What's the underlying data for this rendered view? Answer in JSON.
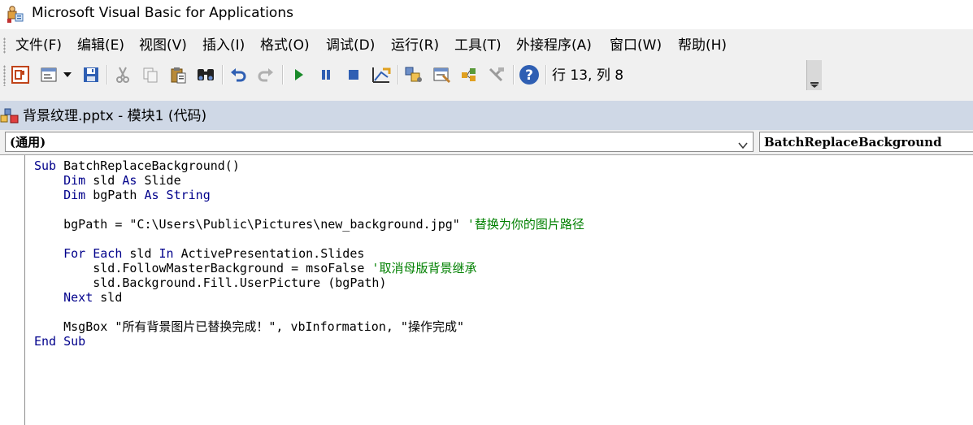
{
  "window": {
    "title": "Microsoft Visual Basic for Applications",
    "icon": "vba-app-icon"
  },
  "menu": [
    {
      "label": "文件(F)"
    },
    {
      "label": "编辑(E)"
    },
    {
      "label": "视图(V)"
    },
    {
      "label": "插入(I)"
    },
    {
      "label": "格式(O)"
    },
    {
      "label": "调试(D)"
    },
    {
      "label": "运行(R)"
    },
    {
      "label": "工具(T)"
    },
    {
      "label": "外接程序(A)"
    },
    {
      "label": "窗口(W)"
    },
    {
      "label": "帮助(H)"
    }
  ],
  "toolbar": {
    "buttons": [
      "view-powerpoint-icon",
      "insert-userform-icon",
      "save-icon",
      "cut-icon",
      "copy-icon",
      "paste-icon",
      "find-icon",
      "undo-icon",
      "redo-icon",
      "run-icon",
      "break-icon",
      "reset-icon",
      "design-mode-icon",
      "project-explorer-icon",
      "properties-window-icon",
      "object-browser-icon",
      "toolbox-icon",
      "help-icon"
    ],
    "status": "行 13, 列 8"
  },
  "code_window": {
    "title": "背景纹理.pptx - 模块1 (代码)",
    "object_combo": "(通用)",
    "procedure_combo": "BatchReplaceBackground"
  },
  "code": {
    "l1_kw": "Sub",
    "l1_rest": " BatchReplaceBackground()",
    "l2_kw": "Dim",
    "l2_a": " sld ",
    "l2_kw2": "As",
    "l2_b": " Slide",
    "l3_kw": "Dim",
    "l3_a": " bgPath ",
    "l3_kw2": "As",
    "l3_kw3": " String",
    "l5_code": "bgPath = \"C:\\Users\\Public\\Pictures\\new_background.jpg\" ",
    "l5_comment": "'替换为你的图片路径",
    "l7_kw": "For Each",
    "l7_a": " sld ",
    "l7_kw2": "In",
    "l7_b": " ActivePresentation.Slides",
    "l8_code": "sld.FollowMasterBackground = msoFalse ",
    "l8_comment": "'取消母版背景继承",
    "l9_code": "sld.Background.Fill.UserPicture (bgPath)",
    "l10_kw": "Next",
    "l10_b": " sld",
    "l12_code": "MsgBox \"所有背景图片已替换完成！\", vbInformation, \"操作完成\"",
    "l13_kw": "End Sub"
  },
  "colors": {
    "keyword": "#00008b",
    "comment": "#008000",
    "code_title_bg": "#cfd8e6"
  }
}
